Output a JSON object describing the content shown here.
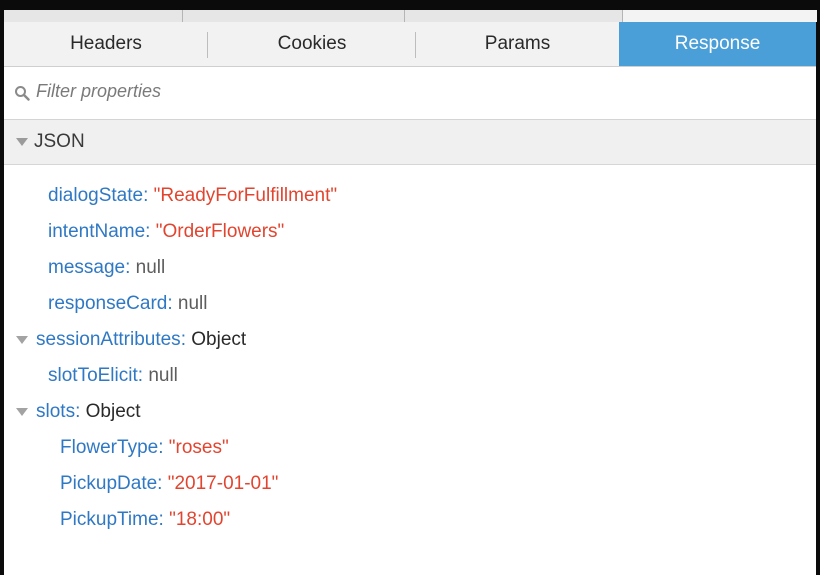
{
  "tabs": [
    {
      "label": "Headers",
      "active": false
    },
    {
      "label": "Cookies",
      "active": false
    },
    {
      "label": "Params",
      "active": false
    },
    {
      "label": "Response",
      "active": true
    }
  ],
  "filter": {
    "placeholder": "Filter properties",
    "icon": "search-icon"
  },
  "section": {
    "title": "JSON",
    "expanded": true
  },
  "tree": [
    {
      "key": "dialogState",
      "value": "\"ReadyForFulfillment\"",
      "type": "string"
    },
    {
      "key": "intentName",
      "value": "\"OrderFlowers\"",
      "type": "string"
    },
    {
      "key": "message",
      "value": "null",
      "type": "null"
    },
    {
      "key": "responseCard",
      "value": "null",
      "type": "null"
    },
    {
      "key": "sessionAttributes",
      "value": "Object",
      "type": "object",
      "expanded": true
    },
    {
      "key": "slotToElicit",
      "value": "null",
      "type": "null"
    },
    {
      "key": "slots",
      "value": "Object",
      "type": "object",
      "expanded": true
    },
    {
      "key": "FlowerType",
      "value": "\"roses\"",
      "type": "string"
    },
    {
      "key": "PickupDate",
      "value": "\"2017-01-01\"",
      "type": "string"
    },
    {
      "key": "PickupTime",
      "value": "\"18:00\"",
      "type": "string"
    }
  ],
  "colors": {
    "active_tab": "#4b9fd8",
    "key": "#2f78c4",
    "string_value": "#e2452f",
    "null_value": "#5d5d5d"
  }
}
